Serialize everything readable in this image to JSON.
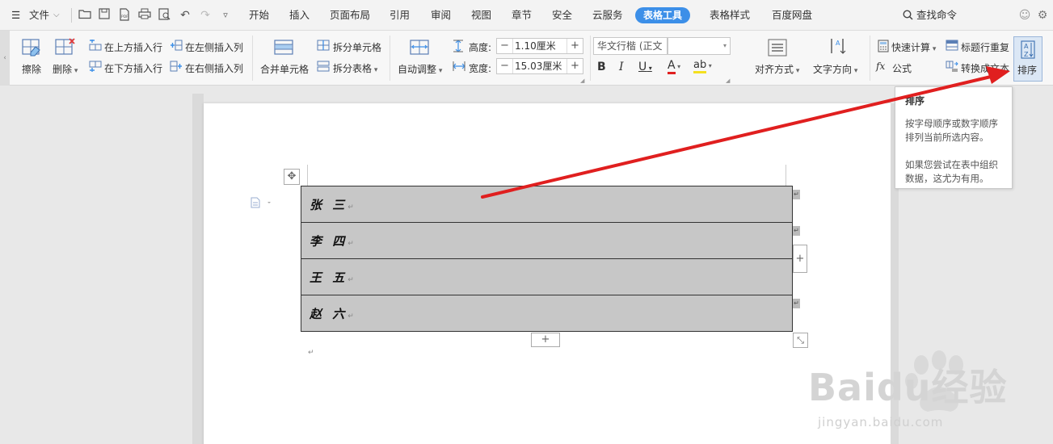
{
  "menubar": {
    "file_label": "文件",
    "tabs": [
      "开始",
      "插入",
      "页面布局",
      "引用",
      "审阅",
      "视图",
      "章节",
      "安全",
      "云服务",
      "表格工具",
      "表格样式",
      "百度网盘"
    ],
    "active_tab": "表格工具",
    "search_label": "查找命令"
  },
  "ribbon": {
    "erase": "擦除",
    "delete": "删除",
    "insert_row_above": "在上方插入行",
    "insert_row_below": "在下方插入行",
    "insert_col_left": "在左侧插入列",
    "insert_col_right": "在右侧插入列",
    "merge_cells": "合并单元格",
    "split_cells": "拆分单元格",
    "split_table": "拆分表格",
    "auto_fit": "自动调整",
    "height_label": "高度:",
    "height_value": "1.10厘米",
    "width_label": "宽度:",
    "width_value": "15.03厘米",
    "font_name": "华文行楷 (正文",
    "align": "对齐方式",
    "text_direction": "文字方向",
    "quick_calc": "快速计算",
    "formula": "公式",
    "repeat_header": "标题行重复",
    "convert_text": "转换成文本",
    "sort": "排序"
  },
  "tooltip": {
    "title": "排序",
    "line1": "按字母顺序或数字顺序排列当前所选内容。",
    "line2": "如果您尝试在表中组织数据，这尤为有用。"
  },
  "table": {
    "rows": [
      "张 三",
      "李 四",
      "王 五",
      "赵 六"
    ]
  },
  "watermark": {
    "brand": "Baidu经验",
    "url": "jingyan.baidu.com"
  },
  "colors": {
    "accent": "#3c8fe8",
    "arrow": "#e01f1f",
    "cell_fill": "#c7c7c7"
  }
}
